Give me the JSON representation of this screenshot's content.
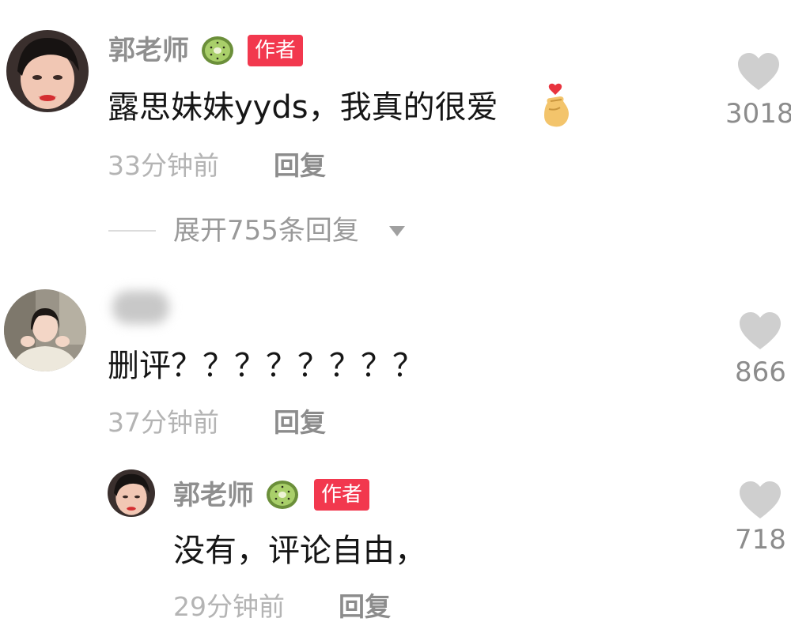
{
  "comments": [
    {
      "username": "郭老师",
      "badge": "作者",
      "text": "露思妹妹yyds，我真的很爱",
      "time": "33分钟前",
      "reply_label": "回复",
      "likes": "3018",
      "expand_label": "展开755条回复",
      "icons": [
        "kiwi-icon",
        "finger-heart-emoji",
        "heart-icon",
        "caret-down-icon"
      ]
    },
    {
      "username": "",
      "text": "删评？？？？？？？？",
      "time": "37分钟前",
      "reply_label": "回复",
      "likes": "866",
      "icons": [
        "heart-icon"
      ]
    }
  ],
  "reply": {
    "username": "郭老师",
    "badge": "作者",
    "text": "没有，评论自由，",
    "time": "29分钟前",
    "reply_label": "回复",
    "likes": "718",
    "icons": [
      "kiwi-icon",
      "heart-icon"
    ]
  },
  "colors": {
    "badge_bg": "#f2384e",
    "username": "#8f8f8f",
    "timestamp": "#b4b4b4",
    "like_icon": "#cfcfcf"
  }
}
